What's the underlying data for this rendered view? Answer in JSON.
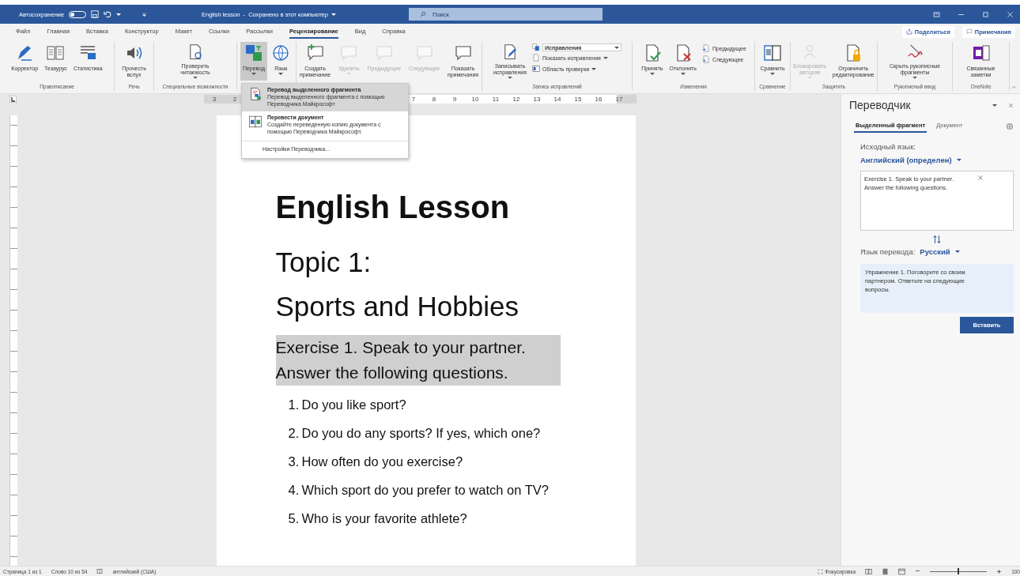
{
  "title_bar": {
    "autosave_label": "Автосохранение",
    "autosave_on": false,
    "document_title": "English lesson  -  Сохранено в этот компьютер",
    "search_placeholder": "Поиск"
  },
  "ribbon_tabs": [
    {
      "label": "Файл",
      "selected": false
    },
    {
      "label": "Главная",
      "selected": false
    },
    {
      "label": "Вставка",
      "selected": false
    },
    {
      "label": "Конструктор",
      "selected": false
    },
    {
      "label": "Макет",
      "selected": false
    },
    {
      "label": "Ссылки",
      "selected": false
    },
    {
      "label": "Рассылки",
      "selected": false
    },
    {
      "label": "Рецензирование",
      "selected": true
    },
    {
      "label": "Вид",
      "selected": false
    },
    {
      "label": "Справка",
      "selected": false
    }
  ],
  "share_button": "Поделиться",
  "comments_button": "Примечания",
  "ribbon_groups": [
    {
      "label": "Правописание",
      "commands": [
        {
          "kind": "large",
          "lines": [
            "Корректор"
          ],
          "dropdown": false,
          "disabled": false,
          "pressed": false
        },
        {
          "kind": "large",
          "lines": [
            "Тезаурус"
          ],
          "dropdown": false,
          "disabled": false,
          "pressed": false
        },
        {
          "kind": "large",
          "lines": [
            "Статистика"
          ],
          "dropdown": false,
          "disabled": false,
          "pressed": false
        }
      ]
    },
    {
      "label": "Речь",
      "commands": [
        {
          "kind": "large",
          "lines": [
            "Прочесть",
            "вслух"
          ],
          "dropdown": false,
          "disabled": false,
          "pressed": false
        }
      ]
    },
    {
      "label": "Специальные возможности",
      "commands": [
        {
          "kind": "large",
          "lines": [
            "Проверить",
            "читаемость"
          ],
          "dropdown": true,
          "disabled": false,
          "pressed": false
        }
      ]
    },
    {
      "commands": [
        {
          "kind": "large",
          "lines": [
            "Перевод"
          ],
          "dropdown": true,
          "disabled": false,
          "pressed": true
        },
        {
          "kind": "large",
          "lines": [
            "Язык"
          ],
          "dropdown": true,
          "disabled": false,
          "pressed": false
        }
      ]
    },
    {
      "commands": [
        {
          "kind": "large",
          "lines": [
            "Создать",
            "примечание"
          ],
          "dropdown": false,
          "disabled": false,
          "pressed": false
        },
        {
          "kind": "large",
          "lines": [
            "Удалить"
          ],
          "dropdown": true,
          "disabled": true,
          "pressed": false
        },
        {
          "kind": "large",
          "lines": [
            "Предыдущее"
          ],
          "dropdown": false,
          "disabled": true,
          "pressed": false
        },
        {
          "kind": "large",
          "lines": [
            "Следующее"
          ],
          "dropdown": false,
          "disabled": true,
          "pressed": false
        },
        {
          "kind": "large",
          "lines": [
            "Показать",
            "примечания"
          ],
          "dropdown": false,
          "disabled": false,
          "pressed": false
        }
      ]
    },
    {
      "label": "Запись исправлений",
      "commands": [
        {
          "kind": "large",
          "lines": [
            "Записывать",
            "исправления"
          ],
          "dropdown": true,
          "disabled": false,
          "pressed": false
        },
        {
          "kind": "combo",
          "lines": [
            "Исправления"
          ],
          "dropdown": true,
          "disabled": false,
          "pressed": false
        },
        {
          "kind": "small",
          "lines": [
            "Показать исправления"
          ],
          "dropdown": true,
          "disabled": false,
          "pressed": false
        },
        {
          "kind": "small",
          "lines": [
            "Область проверки"
          ],
          "dropdown": true,
          "disabled": false,
          "pressed": false
        }
      ]
    },
    {
      "label": "Изменения",
      "commands": [
        {
          "kind": "large",
          "lines": [
            "Принять"
          ],
          "dropdown": true,
          "disabled": false,
          "pressed": false
        },
        {
          "kind": "large",
          "lines": [
            "Отклонить"
          ],
          "dropdown": true,
          "disabled": false,
          "pressed": false
        },
        {
          "kind": "small",
          "lines": [
            "Предыдущее"
          ],
          "dropdown": false,
          "disabled": false,
          "pressed": false
        },
        {
          "kind": "small",
          "lines": [
            "Следующее"
          ],
          "dropdown": false,
          "disabled": false,
          "pressed": false
        }
      ]
    },
    {
      "label": "Сравнение",
      "commands": [
        {
          "kind": "large",
          "lines": [
            "Сравнить"
          ],
          "dropdown": true,
          "disabled": false,
          "pressed": false
        }
      ]
    },
    {
      "label": "Защитить",
      "commands": [
        {
          "kind": "large",
          "lines": [
            "Блокировать",
            "авторов"
          ],
          "dropdown": true,
          "disabled": true,
          "pressed": false
        },
        {
          "kind": "large",
          "lines": [
            "Ограничить",
            "редактирование"
          ],
          "dropdown": false,
          "disabled": false,
          "pressed": false
        }
      ]
    },
    {
      "label": "Рукописный ввод",
      "commands": [
        {
          "kind": "large",
          "lines": [
            "Скрыть рукописные",
            "фрагменты"
          ],
          "dropdown": true,
          "disabled": false,
          "pressed": false
        }
      ]
    },
    {
      "label": "OneNote",
      "commands": [
        {
          "kind": "large",
          "lines": [
            "Связанные",
            "заметки"
          ],
          "dropdown": false,
          "disabled": false,
          "pressed": false
        }
      ]
    }
  ],
  "ruler": {
    "left_numbers": [
      "3",
      "2"
    ],
    "right_numbers": [
      "7",
      "8",
      "9",
      "10",
      "11",
      "12",
      "13",
      "14",
      "15",
      "16",
      "17"
    ]
  },
  "translate_menu": {
    "items": [
      {
        "title": "Перевод выделенного фрагмента",
        "description": "Перевод выделенного фрагмента с помощью Переводчика Майкрософт",
        "highlighted": true
      },
      {
        "title": "Перевести документ",
        "description": "Создайте переведенную копию документа с помощью Переводчика Майкрософт.",
        "highlighted": false
      }
    ],
    "settings": "Настройки Переводчика..."
  },
  "document": {
    "title": "English Lesson",
    "topic_lines": [
      "Topic 1:",
      "Sports and Hobbies"
    ],
    "exercise": {
      "text": "Exercise 1. Speak to your partner. Answer the following questions.",
      "selected": true
    },
    "questions": [
      {
        "number": "1.",
        "text": "Do you like sport?"
      },
      {
        "number": "2.",
        "text": "Do you do any sports? If yes, which one?"
      },
      {
        "number": "3.",
        "text": "How often do you exercise?"
      },
      {
        "number": "4.",
        "text": "Which sport do you prefer to watch on TV?"
      },
      {
        "number": "5.",
        "text": "Who is your favorite athlete?"
      }
    ]
  },
  "translator": {
    "title": "Переводчик",
    "tabs": [
      {
        "label": "Выделенный фрагмент",
        "selected": true
      },
      {
        "label": "Документ",
        "selected": false
      }
    ],
    "source_label": "Исходный язык:",
    "source_language": "Английский (определен)",
    "source_text": "Exercise 1. Speak to your partner. Answer the following questions.",
    "target_label": "Язык перевода:",
    "target_language": "Русский",
    "translation": "Упражнение 1. Поговорите со своим партнером. Ответьте на следующие вопросы.",
    "insert_button": "Вставить"
  },
  "status_bar": {
    "page": "Страница 1 из 1",
    "words": "Слово 10 из 54",
    "language": "английский (США)",
    "focus": "Фокусировка",
    "zoom_slider": {
      "level": 0.5
    },
    "zoom": "100"
  }
}
